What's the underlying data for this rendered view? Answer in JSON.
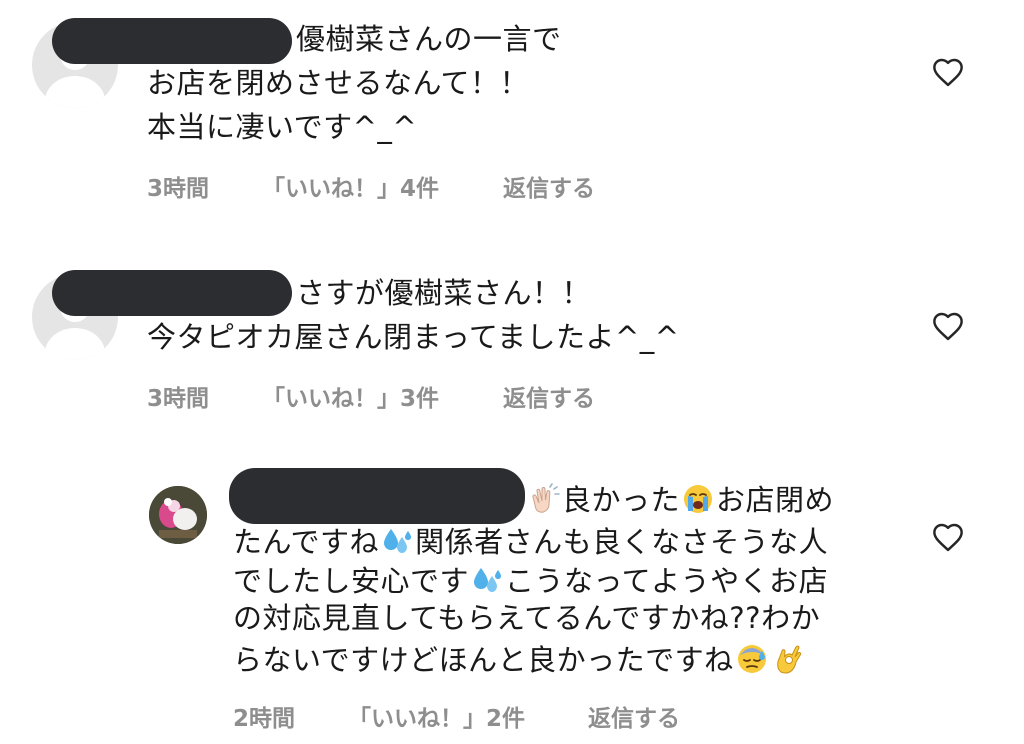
{
  "comments": [
    {
      "lines": [
        "優樹菜さんの一言で",
        "お店を閉めさせるなんて！！",
        "本当に凄いです^_^"
      ],
      "time": "3時間",
      "likes": "「いいね！」4件",
      "reply": "返信する"
    },
    {
      "lines": [
        "さすが優樹菜さん！！",
        "今タピオカ屋さん閉まってましたよ^_^"
      ],
      "time": "3時間",
      "likes": "「いいね！」3件",
      "reply": "返信する"
    },
    {
      "seg1": "良かった",
      "seg2": "お店閉め",
      "seg3": "たんですね",
      "seg4": "関係者さんも良くなさそうな人",
      "seg5": "でしたし安心です",
      "seg6": "こうなってようやくお店",
      "seg7": "の対応見直してもらえてるんですかね??わか",
      "seg8": "らないですけどほんと良かったですね",
      "time": "2時間",
      "likes": "「いいね！」2件",
      "reply": "返信する"
    }
  ],
  "icons": {
    "like": "heart-outline-icon",
    "avatar": "default-user-avatar",
    "clap": "clapping-hands-emoji",
    "crying": "loudly-crying-face-emoji",
    "sweat": "sweat-droplets-emoji",
    "downcast": "downcast-face-with-sweat-emoji",
    "ok": "ok-hand-emoji"
  },
  "colors": {
    "meta": "#8e8e8e",
    "redaction": "#2b2d31",
    "heart": "#262626"
  }
}
